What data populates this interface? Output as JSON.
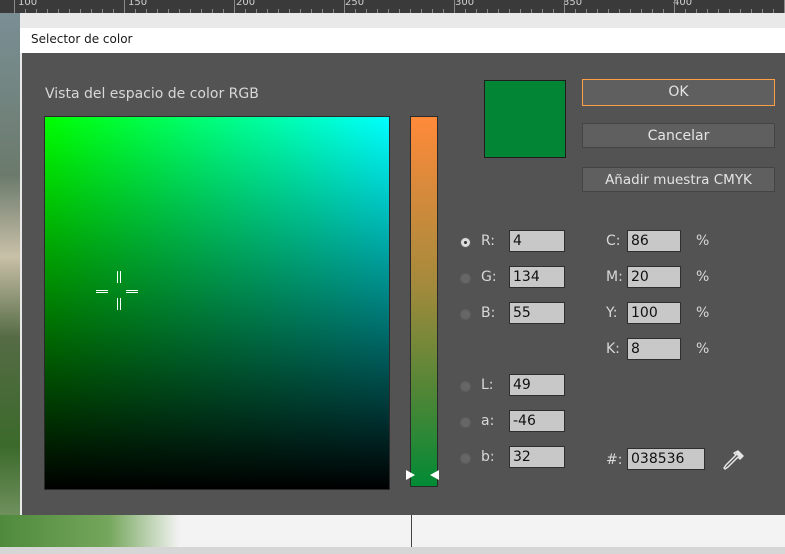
{
  "ruler": {
    "numbers": [
      "100",
      "150",
      "200",
      "250",
      "300",
      "350",
      "400"
    ]
  },
  "dialog": {
    "title": "Selector de color",
    "view_label": "Vista del espacio de color RGB",
    "swatch_color": "#038536",
    "buttons": {
      "ok": "OK",
      "cancel": "Cancelar",
      "add_swatch": "Añadir muestra CMYK"
    },
    "rgb": [
      {
        "label": "R:",
        "value": "4",
        "selected": true
      },
      {
        "label": "G:",
        "value": "134",
        "selected": false
      },
      {
        "label": "B:",
        "value": "55",
        "selected": false
      }
    ],
    "lab": [
      {
        "label": "L:",
        "value": "49",
        "selected": false
      },
      {
        "label": "a:",
        "value": "-46",
        "selected": false
      },
      {
        "label": "b:",
        "value": "32",
        "selected": false
      }
    ],
    "cmyk": [
      {
        "label": "C:",
        "value": "86",
        "unit": "%"
      },
      {
        "label": "M:",
        "value": "20",
        "unit": "%"
      },
      {
        "label": "Y:",
        "value": "100",
        "unit": "%"
      },
      {
        "label": "K:",
        "value": "8",
        "unit": "%"
      }
    ],
    "hex": {
      "label": "#:",
      "value": "038536"
    },
    "icons": [
      "eyedropper-icon"
    ]
  }
}
